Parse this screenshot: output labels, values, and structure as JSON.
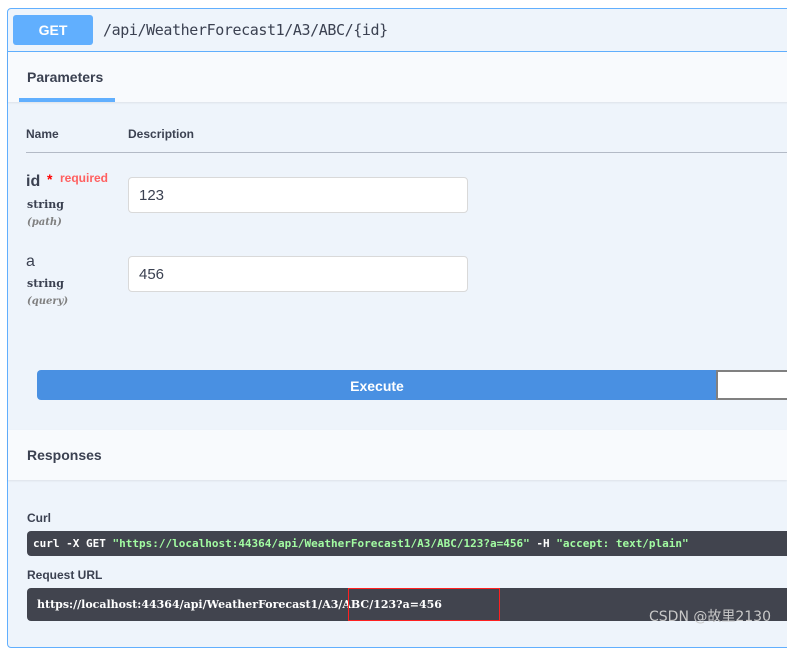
{
  "operation": {
    "method": "GET",
    "path": "/api/WeatherForecast1/A3/ABC/{id}"
  },
  "parameters": {
    "tab_label": "Parameters",
    "col_name": "Name",
    "col_description": "Description",
    "items": [
      {
        "name": "id",
        "required_star": "*",
        "required_text": "required",
        "type": "string",
        "in": "(path)",
        "value": "123"
      },
      {
        "name": "a",
        "type": "string",
        "in": "(query)",
        "value": "456"
      }
    ],
    "execute_label": "Execute"
  },
  "responses": {
    "title": "Responses",
    "curl_label": "Curl",
    "curl_prefix": "curl -X GET ",
    "curl_url": "\"https://localhost:44364/api/WeatherForecast1/A3/ABC/123?a=456\"",
    "curl_flag": " -H ",
    "curl_header": " \"accept: text/plain\"",
    "request_url_label": "Request URL",
    "request_url": "https://localhost:44364/api/WeatherForecast1/A3/ABC/123?a=456"
  },
  "watermark": "CSDN @故里2130",
  "colors": {
    "get_accent": "#61affe",
    "execute_blue": "#4990e2",
    "code_bg": "#41444e",
    "curl_string": "#a2fca2",
    "required_red": "#ff0000",
    "highlight_box": "#ff2020"
  }
}
